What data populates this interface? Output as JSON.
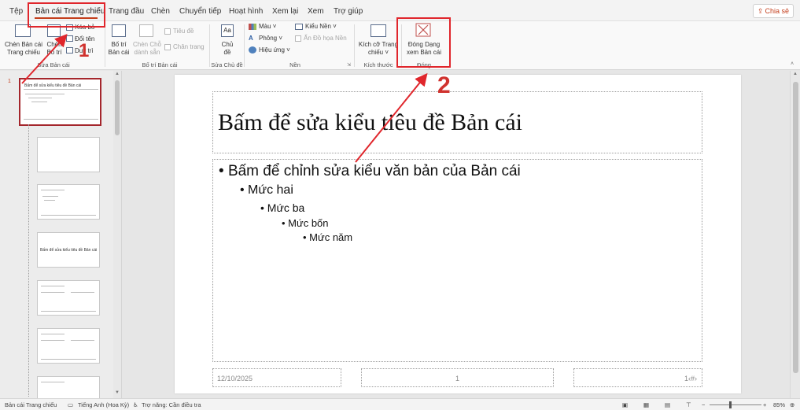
{
  "tabs": [
    {
      "label": "Tệp"
    },
    {
      "label": "Bản cái Trang chiếu"
    },
    {
      "label": "Trang đầu"
    },
    {
      "label": "Chèn"
    },
    {
      "label": "Chuyển tiếp"
    },
    {
      "label": "Hoạt hình"
    },
    {
      "label": "Xem lại"
    },
    {
      "label": "Xem"
    },
    {
      "label": "Trợ giúp"
    }
  ],
  "share_label": "Chia sẻ",
  "ribbon": {
    "edit_master": {
      "insert_master_l1": "Chèn Bản cái",
      "insert_master_l2": "Trang chiếu",
      "insert_layout_l1": "Chèn",
      "insert_layout_l2": "Bố trí",
      "delete": "Xóa bỏ",
      "rename": "Đổi tên",
      "preserve": "Duy trì",
      "group_label": "Sửa Bản cái"
    },
    "master_layout": {
      "layout_l1": "Bố trí",
      "layout_l2": "Bản cái",
      "insert_ph_l1": "Chèn Chỗ",
      "insert_ph_l2": "dành sẵn",
      "title": "Tiêu đề",
      "footers": "Chân trang",
      "group_label": "Bố trí Bản cái"
    },
    "edit_theme": {
      "themes_l1": "Chủ",
      "themes_l2": "đề",
      "group_label": "Sửa Chủ đề"
    },
    "background": {
      "colors": "Màu",
      "fonts": "Phông",
      "effects": "Hiệu ứng",
      "bg_styles": "Kiểu Nền",
      "hide_bg": "Ẩn Đồ họa Nền",
      "group_label": "Nền"
    },
    "size": {
      "slide_size_l1": "Kích cỡ Trang",
      "slide_size_l2": "chiếu",
      "group_label": "Kích thước"
    },
    "close": {
      "close_l1": "Đóng Dạng",
      "close_l2": "xem Bản cái",
      "group_label": "Đóng"
    }
  },
  "thumbnails": {
    "selected_number": "1",
    "selected_title": "Bấm để sửa kiểu tiêu đề Bản cái",
    "section_title": "Bấm để sửa kiểu tiêu đề Bản cái"
  },
  "slide": {
    "title": "Bấm để sửa kiểu tiêu đề Bản cái",
    "bullets": [
      "Bấm để chỉnh sửa kiểu văn bản của Bản cái",
      "Mức hai",
      "Mức ba",
      "Mức bốn",
      "Mức năm"
    ],
    "footer_date": "12/10/2025",
    "footer_center": "1",
    "footer_number": "1‹#›"
  },
  "annotations": {
    "one": "1",
    "two": "2"
  },
  "statusbar": {
    "view": "Bản cái Trang chiếu",
    "language": "Tiếng Anh (Hoa Kỳ)",
    "accessibility": "Trợ năng: Cần điều tra",
    "zoom": "85%"
  },
  "colors": {
    "accent": "#c43e1c",
    "annotation_red": "#e0262c"
  }
}
